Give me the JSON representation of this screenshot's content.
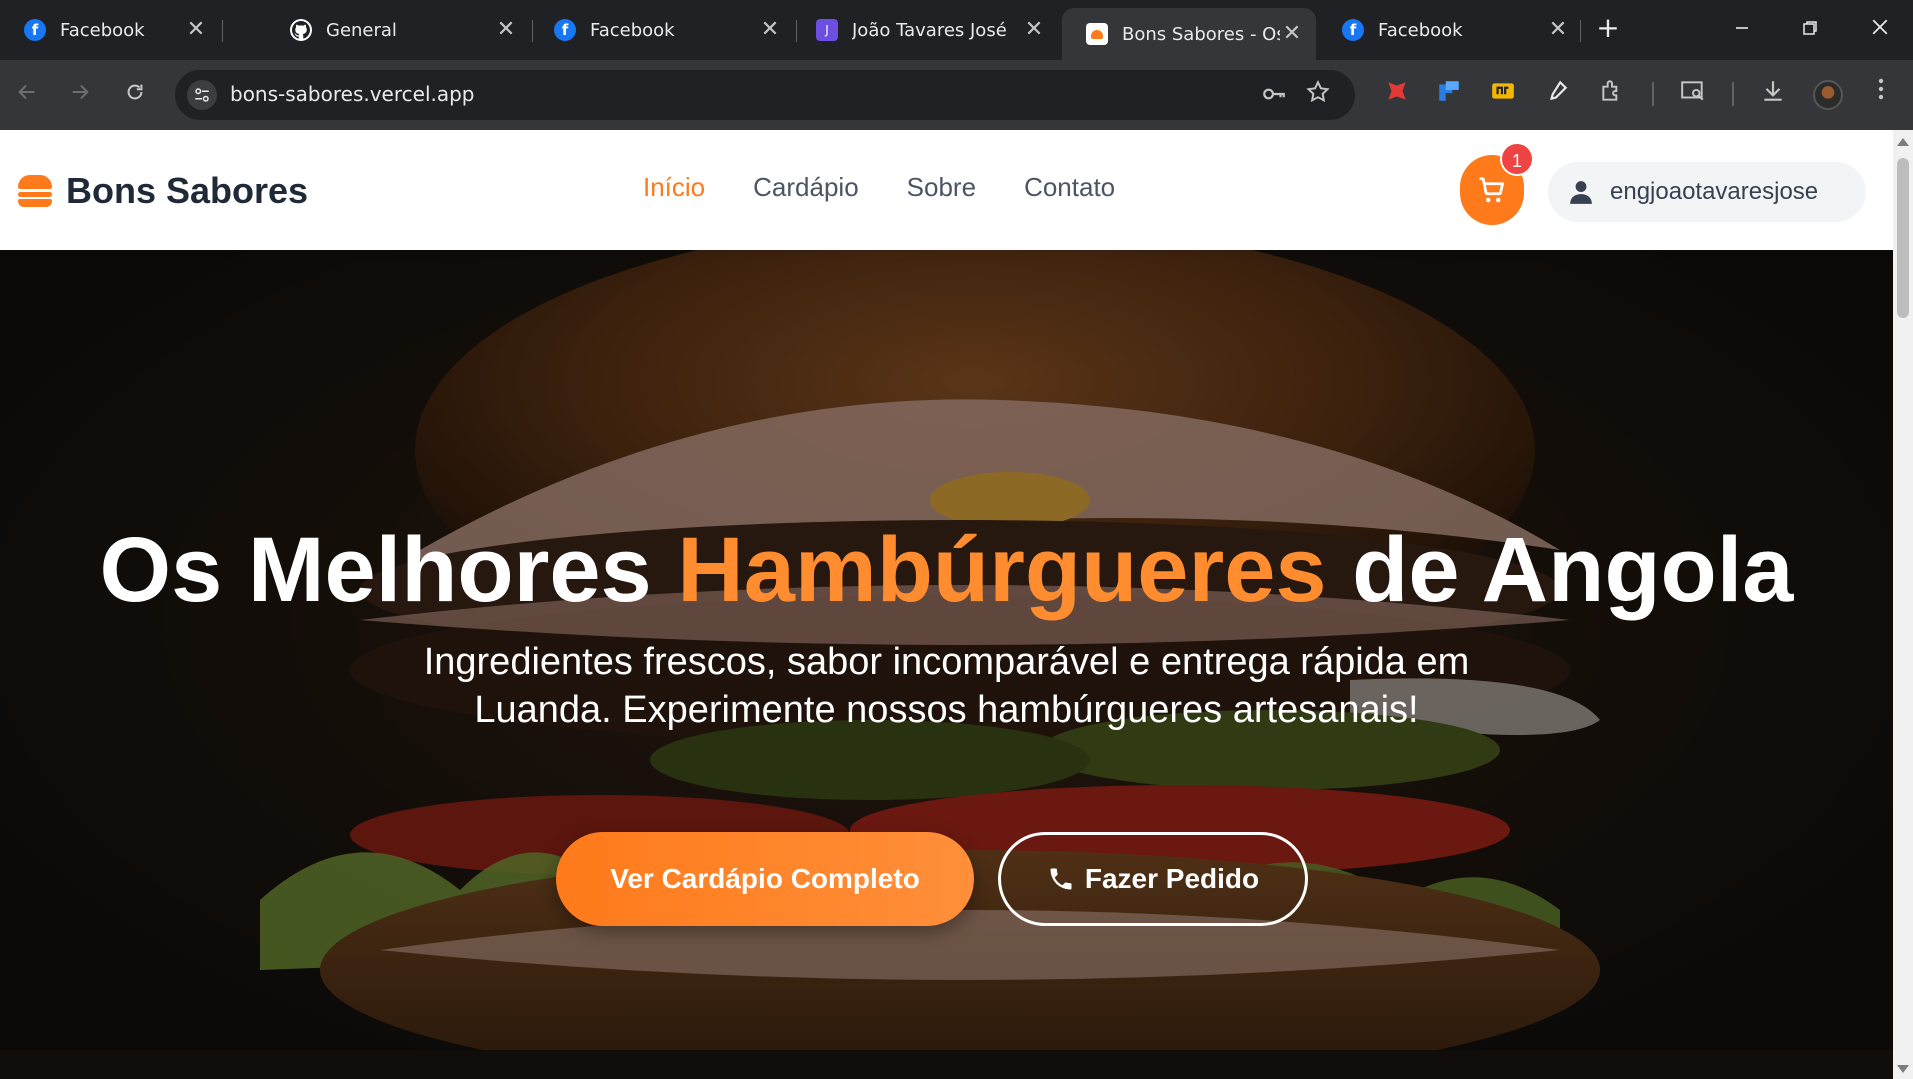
{
  "browser": {
    "tabs": [
      {
        "title": "Facebook",
        "icon": "facebook-icon",
        "active": false
      },
      {
        "title": "General",
        "icon": "github-icon",
        "active": false
      },
      {
        "title": "Facebook",
        "icon": "facebook-icon",
        "active": false
      },
      {
        "title": "João Tavares José",
        "icon": "j-app-icon",
        "active": false
      },
      {
        "title": "Bons Sabores - Os M",
        "icon": "bons-sabores-favicon",
        "active": true
      },
      {
        "title": "Facebook",
        "icon": "facebook-icon",
        "active": false
      }
    ],
    "favicon_letters": {
      "facebook": "f",
      "j_app": "J"
    },
    "close_glyph": "✕",
    "new_tab_glyph": "+",
    "url": "bons-sabores.vercel.app"
  },
  "site": {
    "brand": "Bons Sabores",
    "nav": [
      {
        "label": "Início",
        "active": true
      },
      {
        "label": "Cardápio",
        "active": false
      },
      {
        "label": "Sobre",
        "active": false
      },
      {
        "label": "Contato",
        "active": false
      }
    ],
    "cart_count": "1",
    "username": "engjoaotavaresjose"
  },
  "hero": {
    "title_before": "Os Melhores ",
    "title_accent": "Hambúrgueres",
    "title_after": " de Angola",
    "subtitle": "Ingredientes frescos, sabor incomparável e entrega rápida em Luanda. Experimente nossos hambúrgueres artesanais!",
    "primary_button": "Ver Cardápio Completo",
    "secondary_button": "Fazer Pedido"
  },
  "colors": {
    "accent": "#ff7a1a",
    "accent_text": "#ff8c2e",
    "badge": "#ef4444",
    "browser_dark": "#202124",
    "browser_toolbar": "#35363a"
  }
}
